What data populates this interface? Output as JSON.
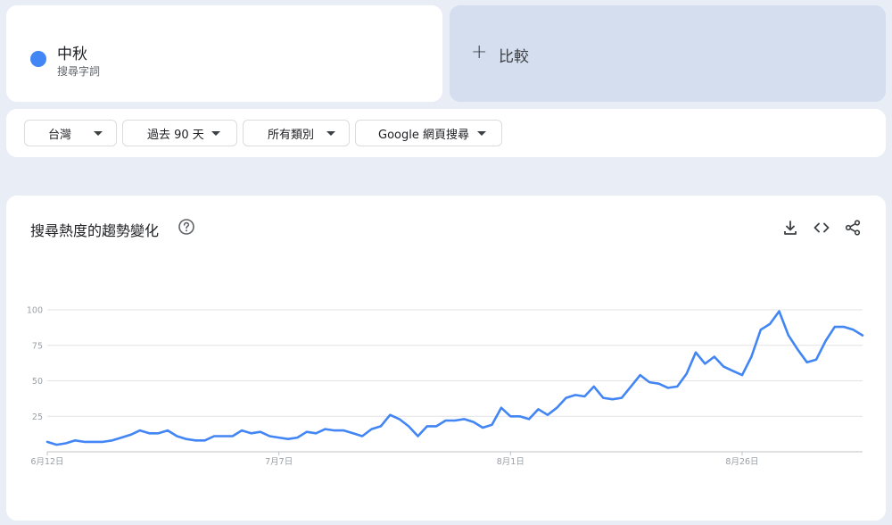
{
  "term": {
    "name": "中秋",
    "subtitle": "搜尋字詞"
  },
  "compare": {
    "plus": "+",
    "label": "比較"
  },
  "filters": {
    "region": "台灣",
    "period": "過去 90 天",
    "category": "所有類別",
    "search_type": "Google 網頁搜尋"
  },
  "chart_section": {
    "title": "搜尋熱度的趨勢變化"
  },
  "colors": {
    "series": "#4285f4",
    "compare_bg": "#d5deef",
    "page_bg": "#e9edf6"
  },
  "icons": [
    "help-icon",
    "download-icon",
    "embed-code-icon",
    "share-icon"
  ],
  "chart_data": {
    "type": "line",
    "title": "",
    "xlabel": "",
    "ylabel": "",
    "ylim": [
      0,
      100
    ],
    "yticks": [
      25,
      50,
      75,
      100
    ],
    "xtick_labels": [
      "6月12日",
      "7月7日",
      "8月1日",
      "8月26日"
    ],
    "xtick_index": [
      0,
      25,
      50,
      75
    ],
    "grid": true,
    "series": [
      {
        "values": [
          7,
          5,
          6,
          8,
          7,
          7,
          7,
          8,
          10,
          12,
          15,
          13,
          13,
          15,
          11,
          9,
          8,
          8,
          11,
          11,
          11,
          15,
          13,
          14,
          11,
          10,
          9,
          10,
          14,
          13,
          16,
          15,
          15,
          13,
          11,
          16,
          18,
          26,
          23,
          18,
          11,
          18,
          18,
          22,
          22,
          23,
          21,
          17,
          19,
          31,
          25,
          25,
          23,
          30,
          26,
          31,
          38,
          40,
          39,
          46,
          38,
          37,
          38,
          46,
          54,
          49,
          48,
          45,
          46,
          55,
          70,
          62,
          67,
          60,
          57,
          54,
          67,
          86,
          90,
          99,
          82,
          72,
          63,
          65,
          78,
          88,
          88,
          86,
          82
        ]
      }
    ]
  }
}
